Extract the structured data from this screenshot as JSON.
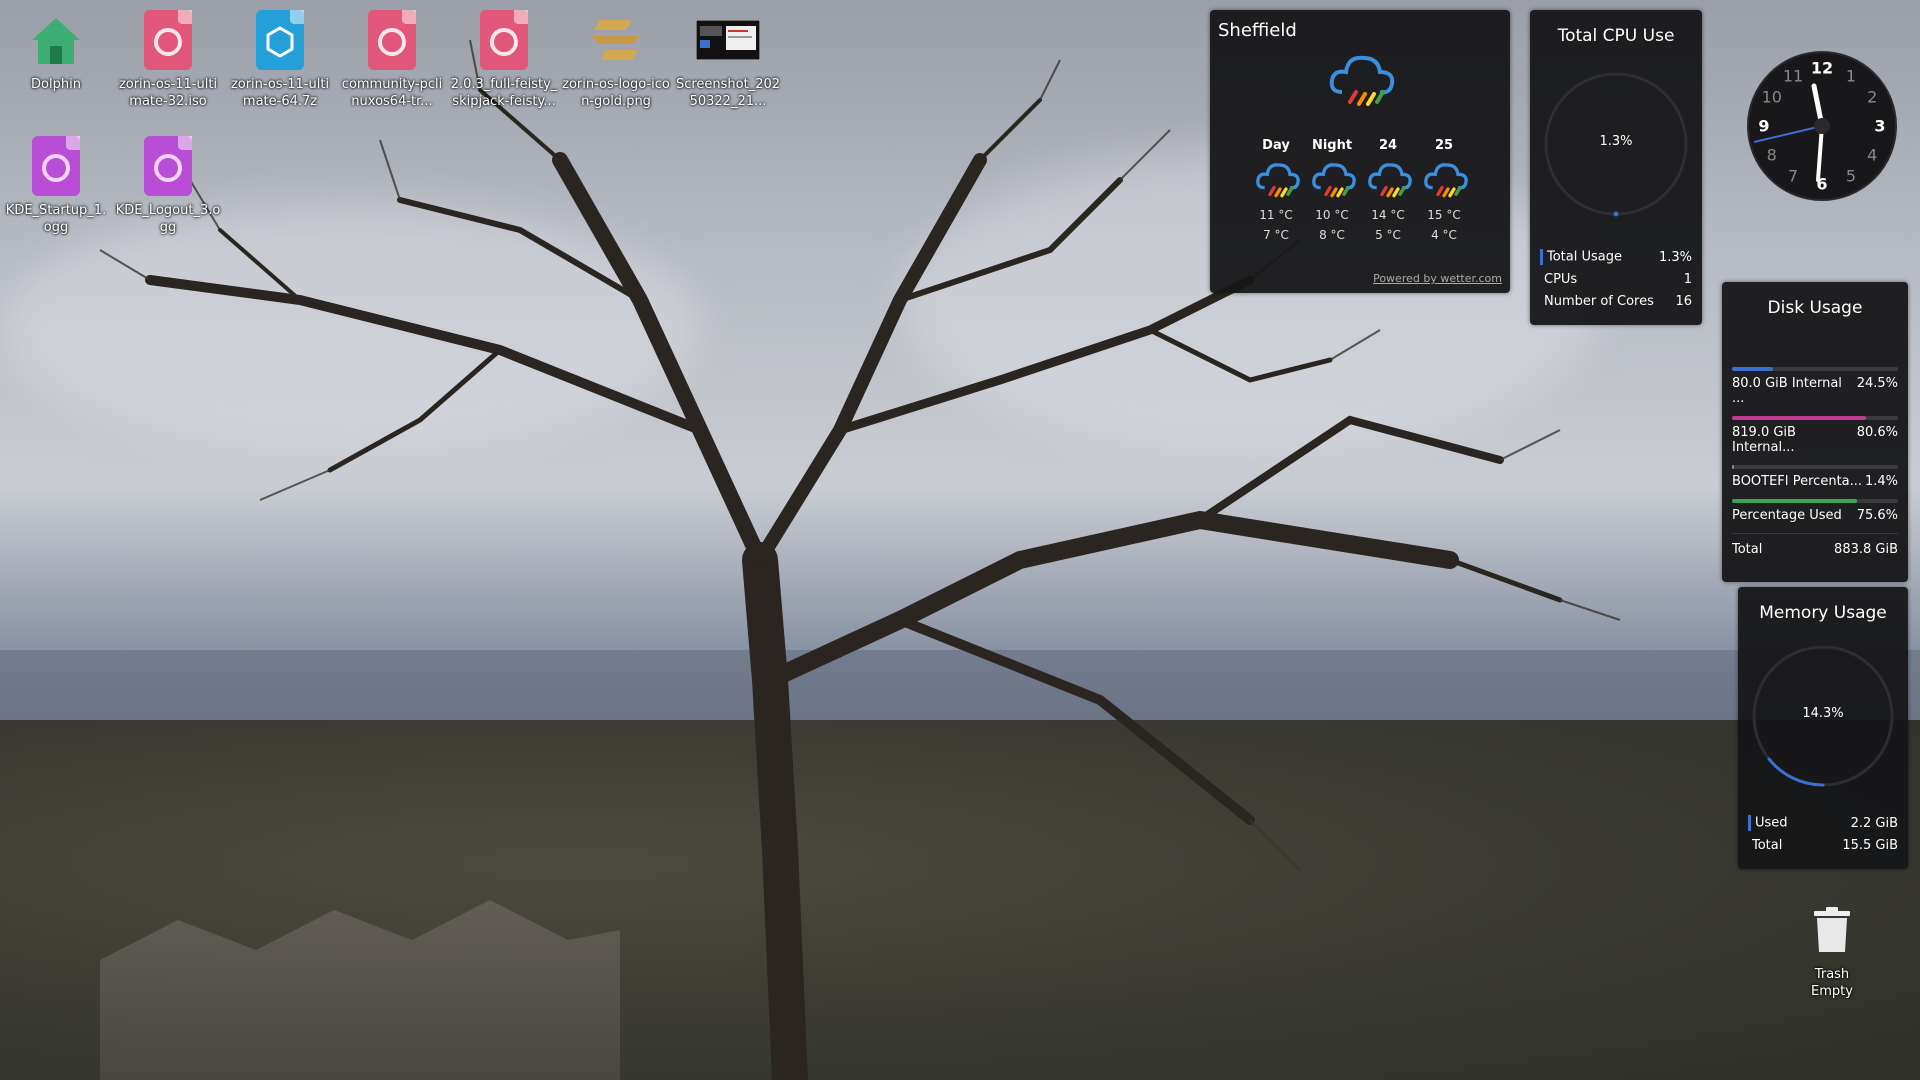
{
  "desktop_icons": [
    {
      "label": "Dolphin",
      "icon": "home-folder-icon",
      "color": "#3dae73"
    },
    {
      "label": "zorin-os-11-ultimate-32.iso",
      "icon": "disc-image-icon",
      "color": "#e0577a"
    },
    {
      "label": "zorin-os-11-ultimate-64.7z",
      "icon": "archive-icon",
      "color": "#23a0d8"
    },
    {
      "label": "community-pclinuxos64-tr...",
      "icon": "disc-image-icon",
      "color": "#e0577a"
    },
    {
      "label": "2.0.3_full-feisty_skipjack-feisty...",
      "icon": "disc-image-icon",
      "color": "#e0577a"
    },
    {
      "label": "zorin-os-logo-icon-gold.png",
      "icon": "zorin-logo-icon",
      "color": "#d4a84f"
    },
    {
      "label": "Screenshot_20250322_21...",
      "icon": "screenshot-thumbnail-icon",
      "color": "#222"
    },
    {
      "label": "KDE_Startup_1.ogg",
      "icon": "audio-file-icon",
      "color": "#b94dd6"
    },
    {
      "label": "KDE_Logout_3.ogg",
      "icon": "audio-file-icon",
      "color": "#b94dd6"
    }
  ],
  "weather": {
    "city": "Sheffield",
    "current_icon": "rain-cloud-icon",
    "forecast": [
      {
        "label": "Day",
        "high": "11 °C",
        "low": "7 °C"
      },
      {
        "label": "Night",
        "high": "10 °C",
        "low": "8 °C"
      },
      {
        "label": "24",
        "high": "14 °C",
        "low": "5 °C"
      },
      {
        "label": "25",
        "high": "15 °C",
        "low": "4 °C"
      }
    ],
    "powered_by": "Powered by wetter.com"
  },
  "cpu": {
    "title": "Total CPU Use",
    "center_value": "1.3%",
    "rows": [
      {
        "label": "Total Usage",
        "value": "1.3%",
        "color": "#3c6fd0"
      },
      {
        "label": "CPUs",
        "value": "1"
      },
      {
        "label": "Number of Cores",
        "value": "16"
      }
    ]
  },
  "clock": {
    "numbers": [
      "12",
      "1",
      "2",
      "3",
      "4",
      "5",
      "6",
      "7",
      "8",
      "9",
      "10",
      "11"
    ],
    "emphasized": [
      "12",
      "3",
      "6",
      "9"
    ]
  },
  "disk": {
    "title": "Disk Usage",
    "rows": [
      {
        "label": "80.0 GiB Internal ...",
        "value": "24.5%",
        "fill": 0.245,
        "color": "#3c6fd0"
      },
      {
        "label": "819.0 GiB Internal...",
        "value": "80.6%",
        "fill": 0.806,
        "color": "#c33a95"
      },
      {
        "label": "BOOTEFI Percenta...",
        "value": "1.4%",
        "fill": 0.014,
        "color": "#888"
      },
      {
        "label": "Percentage Used",
        "value": "75.6%",
        "fill": 0.756,
        "color": "#3aa655"
      }
    ],
    "total_label": "Total",
    "total_value": "883.8 GiB"
  },
  "memory": {
    "title": "Memory Usage",
    "center_value": "14.3%",
    "fill": 0.143,
    "rows": [
      {
        "label": "Used",
        "value": "2.2 GiB",
        "color": "#3c6fd0"
      },
      {
        "label": "Total",
        "value": "15.5 GiB"
      }
    ]
  },
  "trash": {
    "label": "Trash",
    "status": "Empty"
  }
}
